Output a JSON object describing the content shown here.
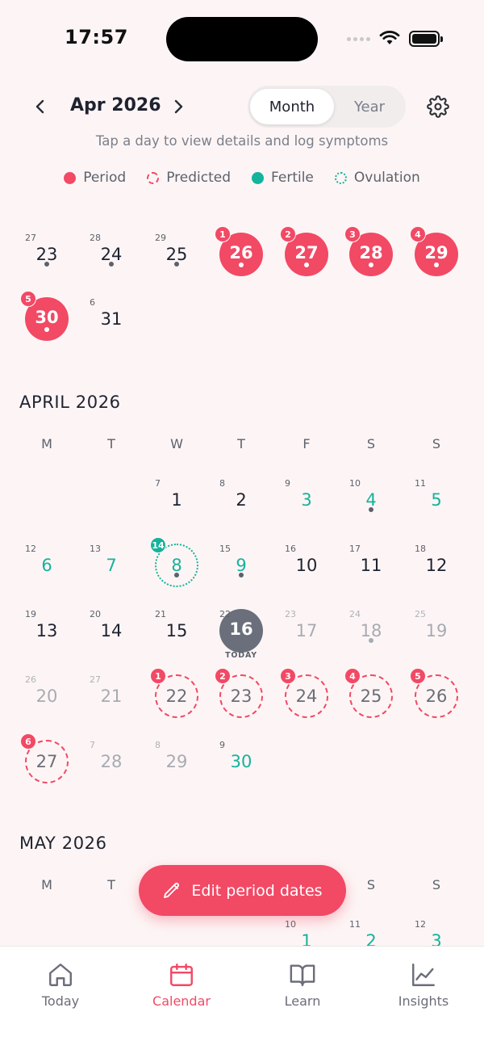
{
  "status_bar": {
    "time": "17:57"
  },
  "header": {
    "month_title": "Apr 2026",
    "view_modes": [
      "Month",
      "Year"
    ],
    "active_view": "Month"
  },
  "hint": "Tap a day to view details and log symptoms",
  "legend": {
    "period": "Period",
    "predicted": "Predicted",
    "fertile": "Fertile",
    "ovulation": "Ovulation"
  },
  "colors": {
    "period": "#f24965",
    "fertile": "#14b39b",
    "today": "#6a6f7b"
  },
  "march_tail": {
    "weeks": [
      [
        {
          "day": "23",
          "cycle_day": "27",
          "dot": true
        },
        {
          "day": "24",
          "cycle_day": "28",
          "dot": true
        },
        {
          "day": "25",
          "cycle_day": "29",
          "dot": true
        },
        {
          "day": "26",
          "badge": "1",
          "type": "period",
          "dot": true
        },
        {
          "day": "27",
          "badge": "2",
          "type": "period",
          "dot": true
        },
        {
          "day": "28",
          "badge": "3",
          "type": "period",
          "dot": true
        },
        {
          "day": "29",
          "badge": "4",
          "type": "period",
          "dot": true
        }
      ],
      [
        {
          "day": "30",
          "badge": "5",
          "type": "period",
          "dot": true
        },
        {
          "day": "31",
          "cycle_day": "6"
        }
      ]
    ]
  },
  "april": {
    "title": "APRIL 2026",
    "weekdays": [
      "M",
      "T",
      "W",
      "T",
      "F",
      "S",
      "S"
    ],
    "weeks": [
      [
        null,
        null,
        {
          "day": "1",
          "cycle_day": "7"
        },
        {
          "day": "2",
          "cycle_day": "8"
        },
        {
          "day": "3",
          "cycle_day": "9",
          "type": "fertile"
        },
        {
          "day": "4",
          "cycle_day": "10",
          "type": "fertile",
          "dot": true
        },
        {
          "day": "5",
          "cycle_day": "11",
          "type": "fertile"
        }
      ],
      [
        {
          "day": "6",
          "cycle_day": "12",
          "type": "fertile"
        },
        {
          "day": "7",
          "cycle_day": "13",
          "type": "fertile"
        },
        {
          "day": "8",
          "badge": "14",
          "type": "ovulation",
          "dot": true
        },
        {
          "day": "9",
          "cycle_day": "15",
          "type": "fertile",
          "dot": true
        },
        {
          "day": "10",
          "cycle_day": "16"
        },
        {
          "day": "11",
          "cycle_day": "17"
        },
        {
          "day": "12",
          "cycle_day": "18"
        }
      ],
      [
        {
          "day": "13",
          "cycle_day": "19"
        },
        {
          "day": "14",
          "cycle_day": "20"
        },
        {
          "day": "15",
          "cycle_day": "21"
        },
        {
          "day": "16",
          "cycle_day": "22",
          "type": "today",
          "label": "TODAY"
        },
        {
          "day": "17",
          "cycle_day": "23",
          "future": true
        },
        {
          "day": "18",
          "cycle_day": "24",
          "future": true,
          "dot": true
        },
        {
          "day": "19",
          "cycle_day": "25",
          "future": true
        }
      ],
      [
        {
          "day": "20",
          "cycle_day": "26",
          "future": true
        },
        {
          "day": "21",
          "cycle_day": "27",
          "future": true
        },
        {
          "day": "22",
          "badge": "1",
          "type": "predicted"
        },
        {
          "day": "23",
          "badge": "2",
          "type": "predicted"
        },
        {
          "day": "24",
          "badge": "3",
          "type": "predicted"
        },
        {
          "day": "25",
          "badge": "4",
          "type": "predicted"
        },
        {
          "day": "26",
          "badge": "5",
          "type": "predicted"
        }
      ],
      [
        {
          "day": "27",
          "badge": "6",
          "type": "predicted"
        },
        {
          "day": "28",
          "cycle_day": "7",
          "future": true
        },
        {
          "day": "29",
          "cycle_day": "8",
          "future": true
        },
        {
          "day": "30",
          "cycle_day": "9",
          "type": "fertile"
        },
        null,
        null,
        null
      ]
    ]
  },
  "may": {
    "title": "MAY 2026",
    "weekdays": [
      "M",
      "T",
      "W",
      "T",
      "F",
      "S",
      "S"
    ],
    "weeks": [
      [
        null,
        null,
        null,
        null,
        {
          "day": "1",
          "cycle_day": "10",
          "type": "fertile"
        },
        {
          "day": "2",
          "cycle_day": "11",
          "type": "fertile"
        },
        {
          "day": "3",
          "cycle_day": "12",
          "type": "fertile"
        }
      ]
    ]
  },
  "fab": {
    "label": "Edit period dates"
  },
  "bottom_nav": {
    "tabs": [
      {
        "label": "Today",
        "icon": "home-icon"
      },
      {
        "label": "Calendar",
        "icon": "calendar-icon",
        "active": true
      },
      {
        "label": "Learn",
        "icon": "book-icon"
      },
      {
        "label": "Insights",
        "icon": "chart-icon"
      }
    ]
  }
}
